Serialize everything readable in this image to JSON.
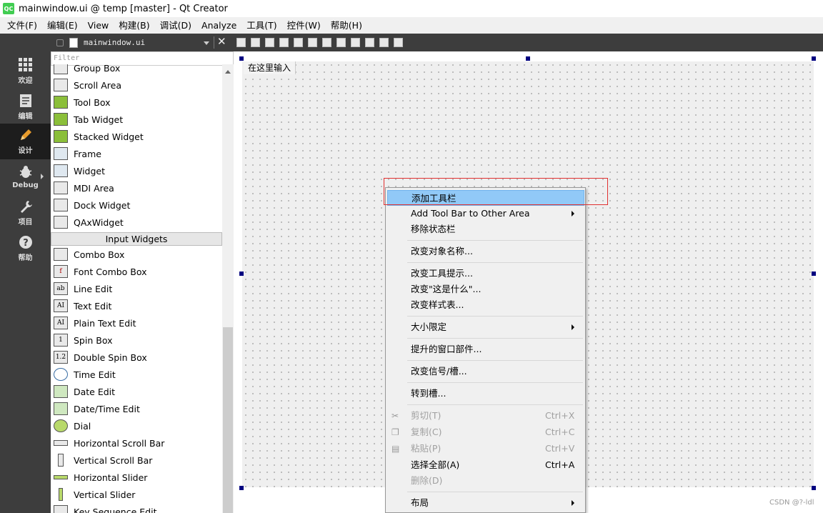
{
  "window": {
    "title": "mainwindow.ui @ temp [master] - Qt Creator",
    "logo": "QC"
  },
  "menubar": {
    "items": [
      "文件(F)",
      "编辑(E)",
      "View",
      "构建(B)",
      "调试(D)",
      "Analyze",
      "工具(T)",
      "控件(W)",
      "帮助(H)"
    ]
  },
  "modes": [
    {
      "label": "欢迎",
      "icon": "grid-icon"
    },
    {
      "label": "编辑",
      "icon": "document-icon"
    },
    {
      "label": "设计",
      "icon": "pencil-icon"
    },
    {
      "label": "Debug",
      "icon": "bug-icon"
    },
    {
      "label": "项目",
      "icon": "wrench-icon"
    },
    {
      "label": "帮助",
      "icon": "help-icon"
    }
  ],
  "editor": {
    "filename": "mainwindow.ui"
  },
  "widgetbox": {
    "filter_placeholder": "Filter",
    "containers": [
      "Group Box",
      "Scroll Area",
      "Tool Box",
      "Tab Widget",
      "Stacked Widget",
      "Frame",
      "Widget",
      "MDI Area",
      "Dock Widget",
      "QAxWidget"
    ],
    "category": "Input Widgets",
    "inputs": [
      "Combo Box",
      "Font Combo Box",
      "Line Edit",
      "Text Edit",
      "Plain Text Edit",
      "Spin Box",
      "Double Spin Box",
      "Time Edit",
      "Date Edit",
      "Date/Time Edit",
      "Dial",
      "Horizontal Scroll Bar",
      "Vertical Scroll Bar",
      "Horizontal Slider",
      "Vertical Slider",
      "Key Sequence Edit"
    ]
  },
  "form": {
    "menu_placeholder": "在这里输入"
  },
  "context_menu": {
    "items": [
      {
        "label": "添加工具栏",
        "highlight": true
      },
      {
        "label": "Add Tool Bar to Other Area",
        "submenu": true
      },
      {
        "label": "移除状态栏"
      },
      {
        "label": "改变对象名称..."
      },
      {
        "label": "改变工具提示..."
      },
      {
        "label": "改变\"这是什么\"..."
      },
      {
        "label": "改变样式表..."
      },
      {
        "label": "大小限定",
        "submenu": true
      },
      {
        "label": "提升的窗口部件..."
      },
      {
        "label": "改变信号/槽..."
      },
      {
        "label": "转到槽..."
      },
      {
        "label": "剪切(T)",
        "shortcut": "Ctrl+X",
        "disabled": true,
        "icon": "scissors-icon"
      },
      {
        "label": "复制(C)",
        "shortcut": "Ctrl+C",
        "disabled": true,
        "icon": "copy-icon"
      },
      {
        "label": "粘贴(P)",
        "shortcut": "Ctrl+V",
        "disabled": true,
        "icon": "paste-icon"
      },
      {
        "label": "选择全部(A)",
        "shortcut": "Ctrl+A"
      },
      {
        "label": "删除(D)",
        "disabled": true
      },
      {
        "label": "布局",
        "submenu": true
      }
    ]
  },
  "watermark": "CSDN @?-ldl",
  "colors": {
    "highlight": "#91c9f7",
    "annotation": "#e03030",
    "handle": "#000080",
    "modebar": "#3d3d3d"
  }
}
